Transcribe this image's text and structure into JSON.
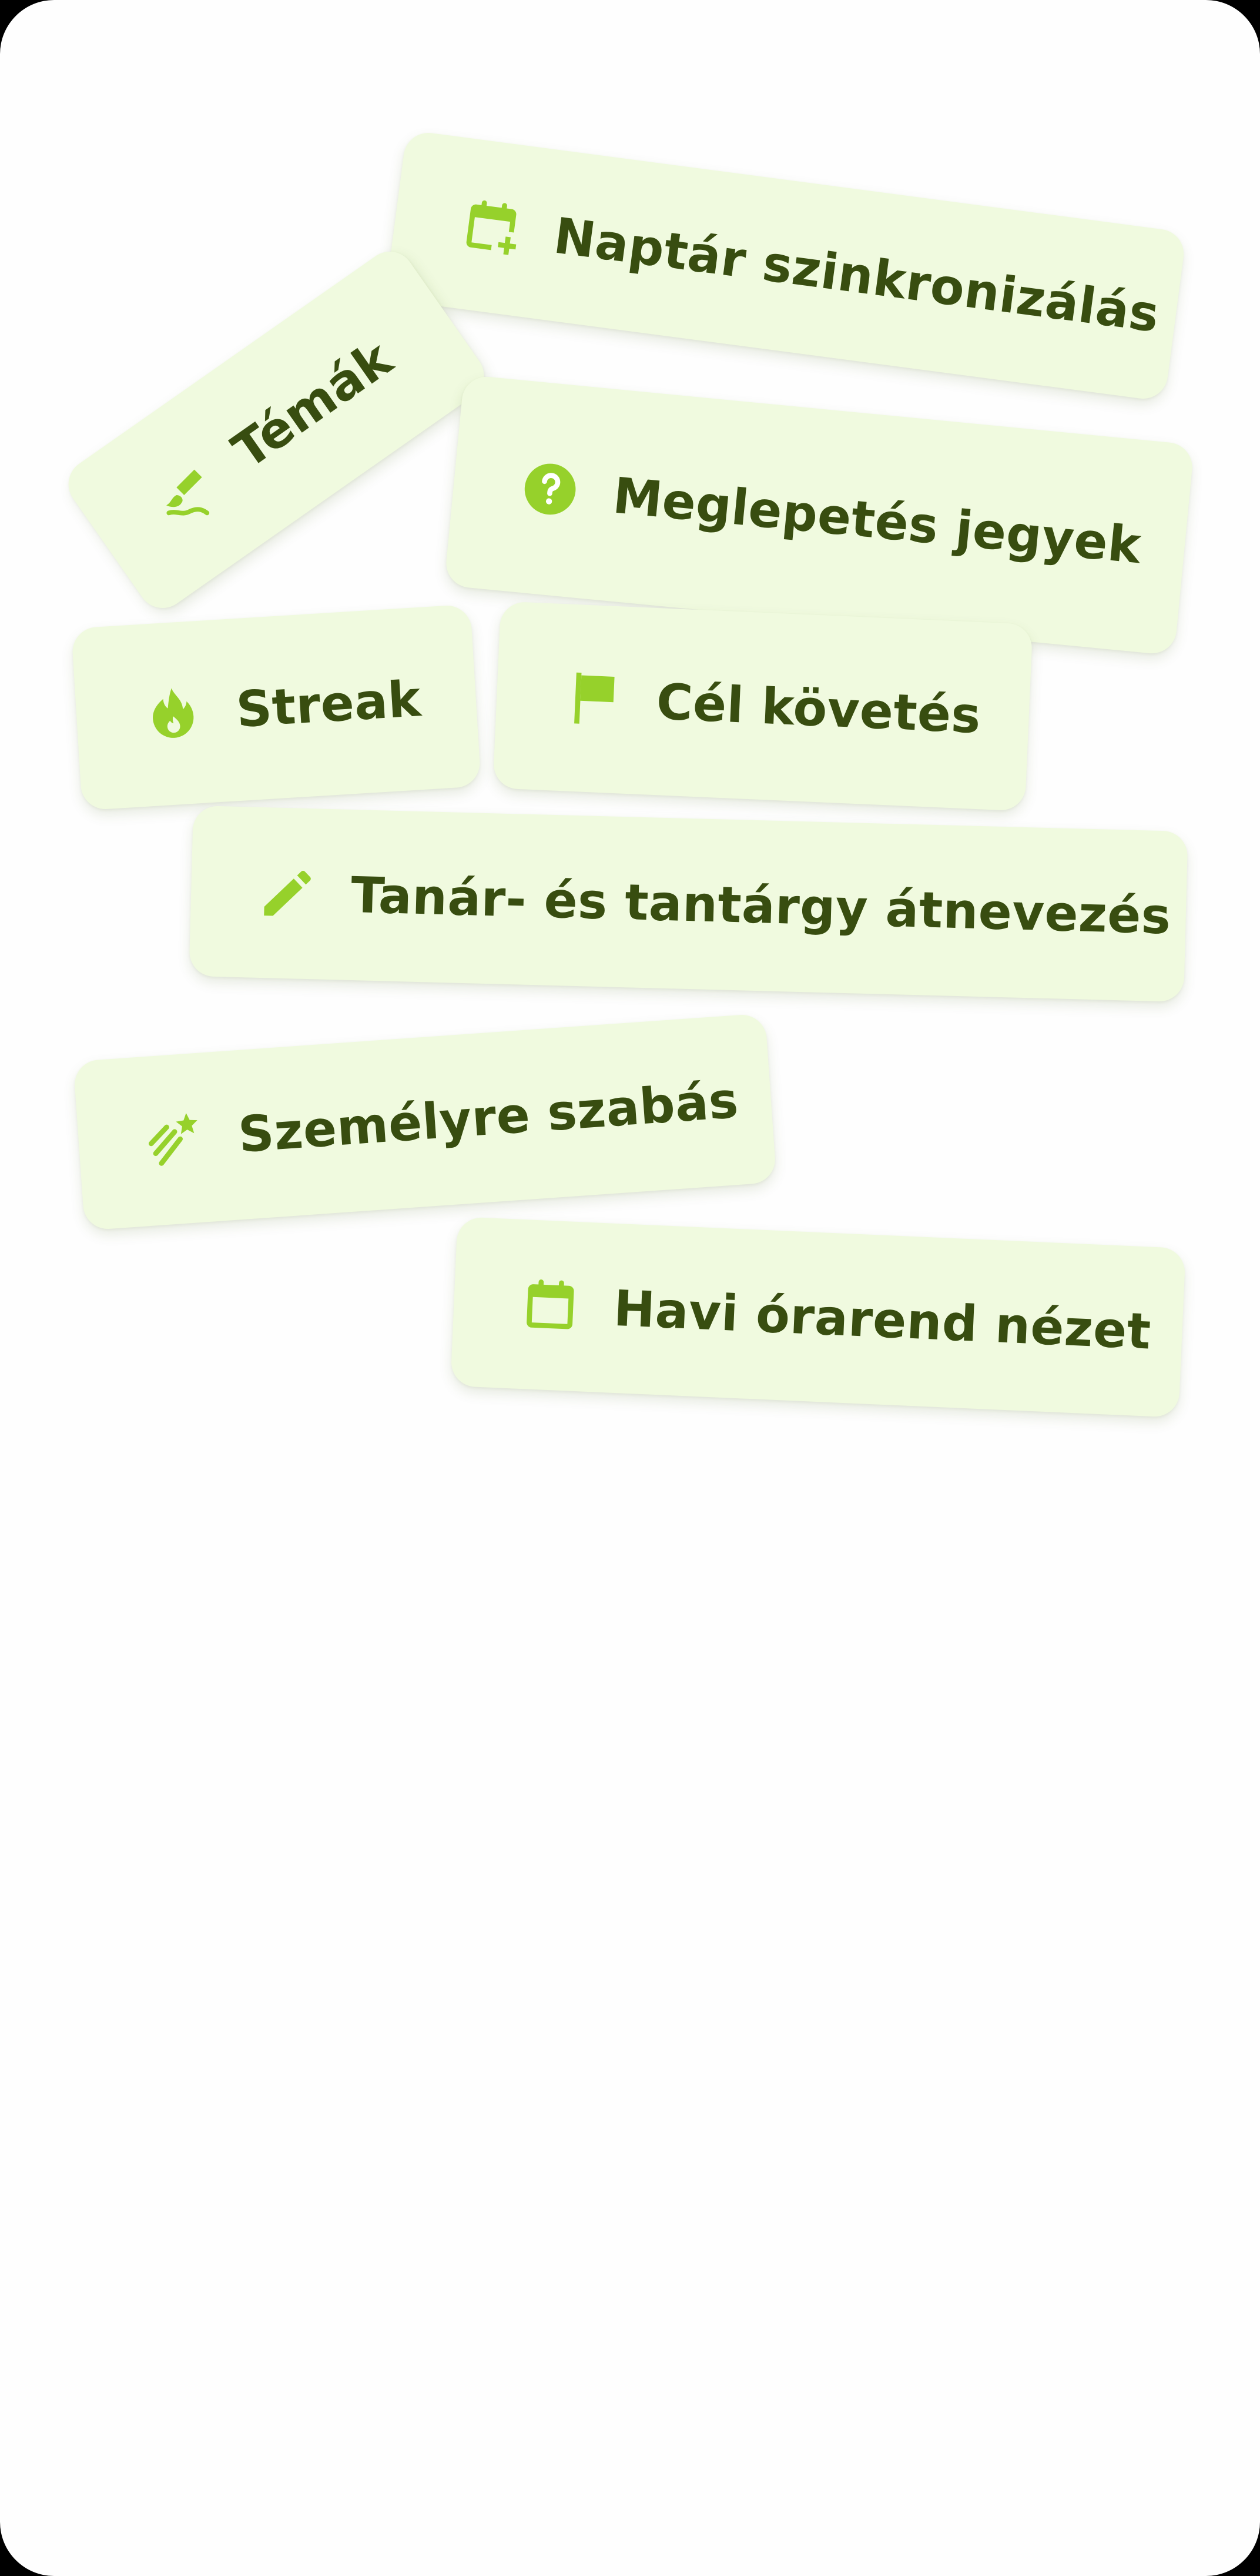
{
  "theme": {
    "chip_background": "#f0fadf",
    "icon_color": "#96d12b",
    "text_color": "#384d10"
  },
  "features": [
    {
      "id": "calendar-sync",
      "label": "Naptár szinkronizálás",
      "icon": "calendar-plus-icon"
    },
    {
      "id": "themes",
      "label": "Témák",
      "icon": "brush-icon"
    },
    {
      "id": "surprise-grades",
      "label": "Meglepetés jegyek",
      "icon": "question-circle-icon"
    },
    {
      "id": "streak",
      "label": "Streak",
      "icon": "flame-icon"
    },
    {
      "id": "goal-tracking",
      "label": "Cél követés",
      "icon": "flag-icon"
    },
    {
      "id": "rename",
      "label": "Tanár- és tantárgy átnevezés",
      "icon": "pencil-icon"
    },
    {
      "id": "personalization",
      "label": "Személyre szabás",
      "icon": "shooting-star-icon"
    },
    {
      "id": "monthly-timetable",
      "label": "Havi órarend nézet",
      "icon": "calendar-icon"
    }
  ]
}
